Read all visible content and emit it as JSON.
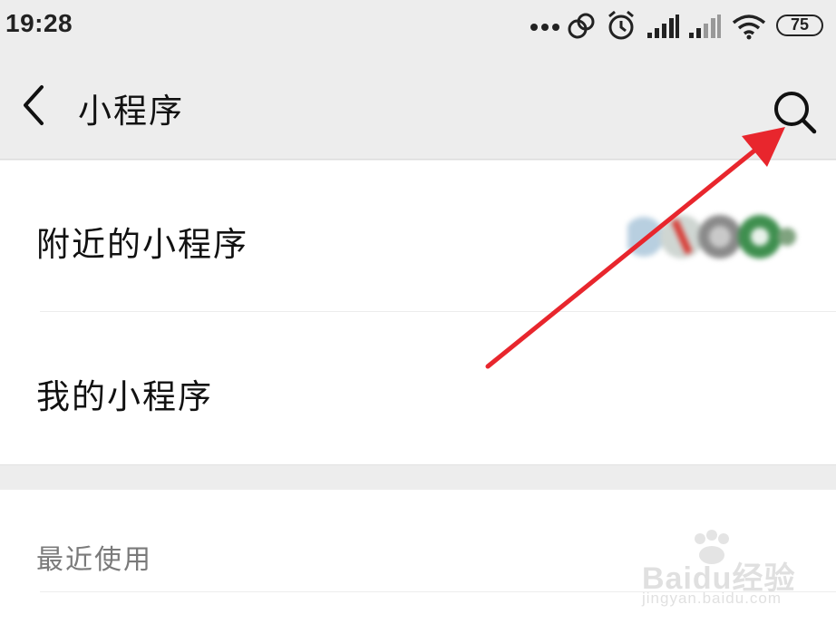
{
  "status_bar": {
    "time": "19:28",
    "battery_level": "75",
    "icons": [
      "more-dots-icon",
      "link-icon",
      "alarm-icon",
      "signal-icon",
      "signal-icon",
      "wifi-icon",
      "battery-icon"
    ]
  },
  "nav": {
    "title": "小程序",
    "back_icon": "chevron-left-icon",
    "search_icon": "search-icon"
  },
  "menu": {
    "items": [
      {
        "label": "附近的小程序"
      },
      {
        "label": "我的小程序"
      }
    ]
  },
  "recent": {
    "label": "最近使用"
  },
  "watermark": {
    "brand": "Baidu经验",
    "url": "jingyan.baidu.com"
  },
  "colors": {
    "background": "#ededed",
    "surface": "#ffffff",
    "annotation_arrow": "#e8262d"
  }
}
